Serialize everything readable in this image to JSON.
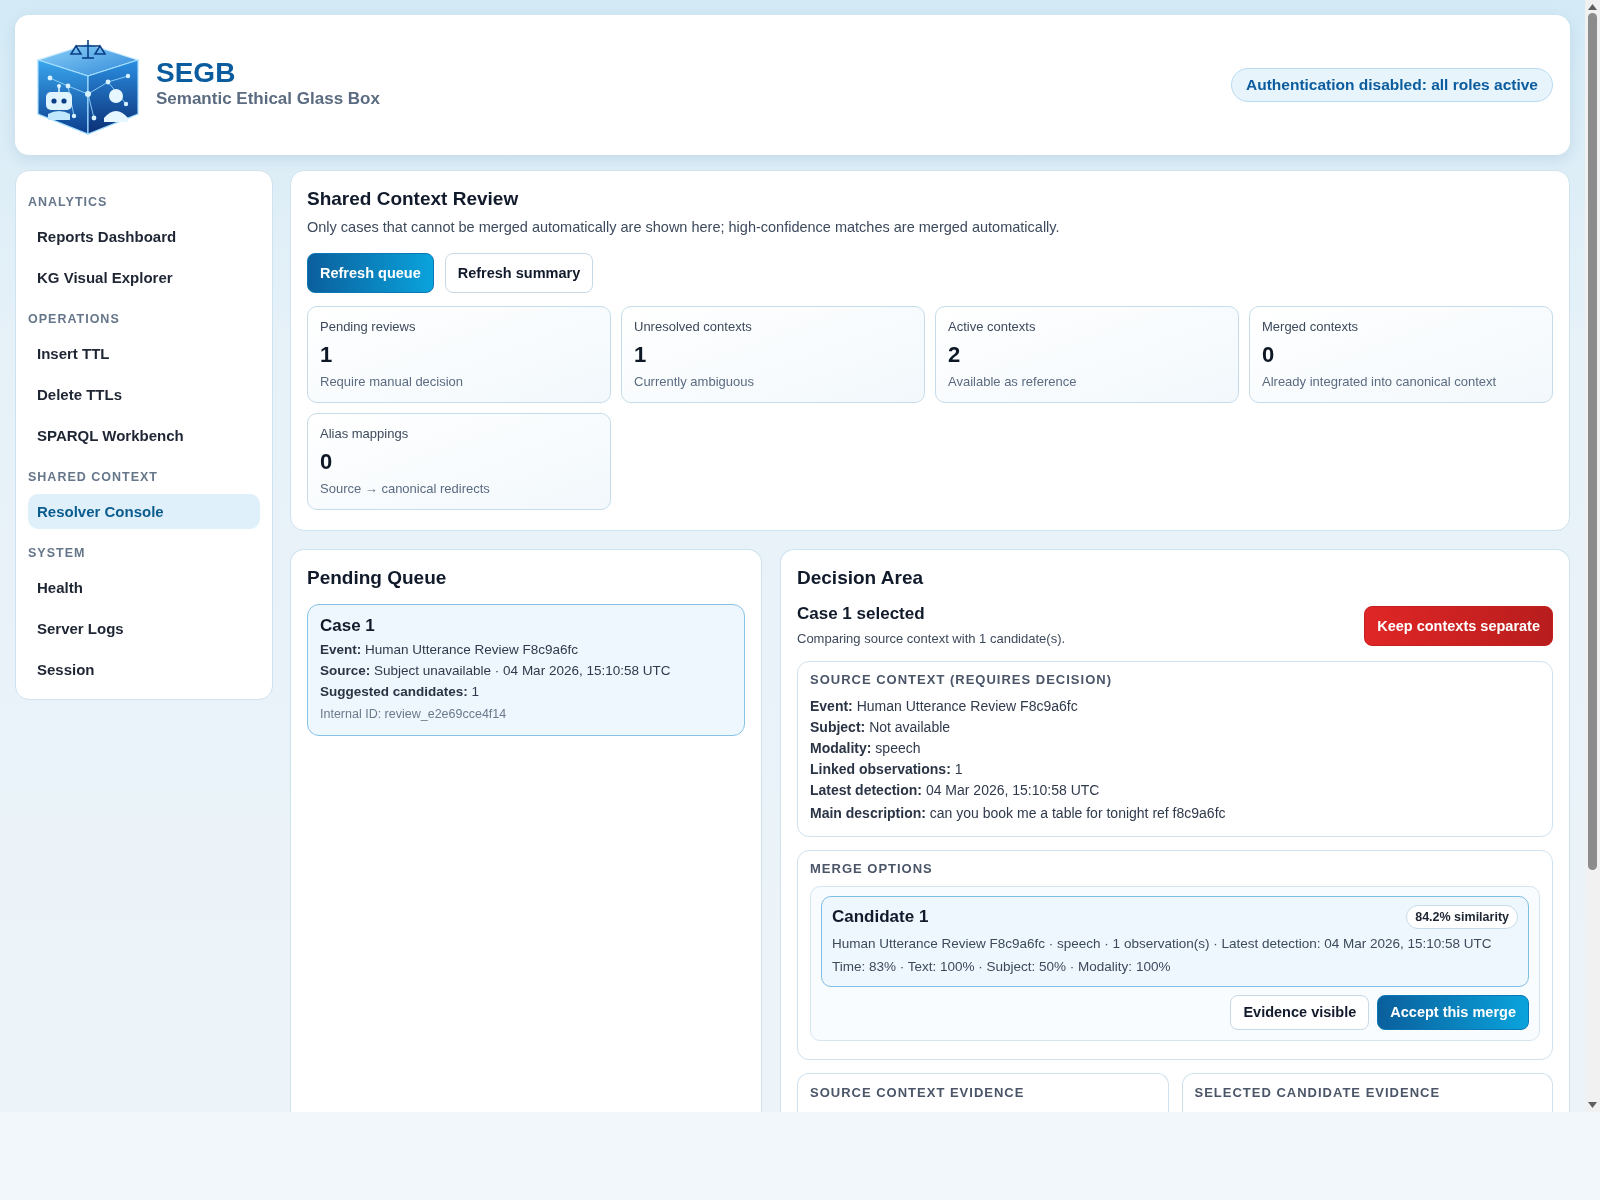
{
  "header": {
    "title": "SEGB",
    "subtitle": "Semantic Ethical Glass Box",
    "auth_badge": "Authentication disabled: all roles active"
  },
  "sidebar": {
    "sections": [
      {
        "heading": "ANALYTICS",
        "items": [
          {
            "label": "Reports Dashboard",
            "selected": false
          },
          {
            "label": "KG Visual Explorer",
            "selected": false
          }
        ]
      },
      {
        "heading": "OPERATIONS",
        "items": [
          {
            "label": "Insert TTL",
            "selected": false
          },
          {
            "label": "Delete TTLs",
            "selected": false
          },
          {
            "label": "SPARQL Workbench",
            "selected": false
          }
        ]
      },
      {
        "heading": "SHARED CONTEXT",
        "items": [
          {
            "label": "Resolver Console",
            "selected": true
          }
        ]
      },
      {
        "heading": "SYSTEM",
        "items": [
          {
            "label": "Health",
            "selected": false
          },
          {
            "label": "Server Logs",
            "selected": false
          },
          {
            "label": "Session",
            "selected": false
          }
        ]
      }
    ]
  },
  "review": {
    "title": "Shared Context Review",
    "description": "Only cases that cannot be merged automatically are shown here; high-confidence matches are merged automatically.",
    "buttons": [
      {
        "label": "Refresh queue",
        "kind": "primary"
      },
      {
        "label": "Refresh summary",
        "kind": "secondary"
      }
    ],
    "stats": [
      {
        "label": "Pending reviews",
        "value": "1",
        "note": "Require manual decision"
      },
      {
        "label": "Unresolved contexts",
        "value": "1",
        "note": "Currently ambiguous"
      },
      {
        "label": "Active contexts",
        "value": "2",
        "note": "Available as reference"
      },
      {
        "label": "Merged contexts",
        "value": "0",
        "note": "Already integrated into canonical context"
      },
      {
        "label": "Alias mappings",
        "value": "0",
        "note": "Source → canonical redirects"
      }
    ]
  },
  "pending_queue": {
    "title": "Pending Queue",
    "cases": [
      {
        "title": "Case 1",
        "selected": true,
        "fields": [
          {
            "label": "Event:",
            "value": "Human Utterance Review F8c9a6fc"
          },
          {
            "label": "Source:",
            "value": "Subject unavailable · 04 Mar 2026, 15:10:58 UTC"
          },
          {
            "label": "Suggested candidates:",
            "value": "1"
          }
        ],
        "internal_id": "Internal ID: review_e2e69cce4f14"
      }
    ]
  },
  "decision": {
    "title": "Decision Area",
    "case_title": "Case 1 selected",
    "comparison": "Comparing source context with 1 candidate(s).",
    "reject_button": {
      "label": "Keep contexts separate",
      "kind": "danger"
    },
    "source_context": {
      "heading": "SOURCE CONTEXT (REQUIRES DECISION)",
      "fields": [
        {
          "label": "Event:",
          "value": "Human Utterance Review F8c9a6fc"
        },
        {
          "label": "Subject:",
          "value": "Not available"
        },
        {
          "label": "Modality:",
          "value": "speech"
        },
        {
          "label": "Linked observations:",
          "value": "1"
        },
        {
          "label": "Latest detection:",
          "value": "04 Mar 2026, 15:10:58 UTC"
        },
        {
          "label": "Main description:",
          "value": "can you book me a table for tonight ref f8c9a6fc"
        }
      ]
    },
    "merge_options": {
      "heading": "MERGE OPTIONS",
      "candidates": [
        {
          "title": "Candidate 1",
          "similarity": "84.2% similarity",
          "selected": true,
          "summary": "Human Utterance Review F8c9a6fc · speech · 1 observation(s) · Latest detection: 04 Mar 2026, 15:10:58 UTC",
          "scores": "Time: 83% · Text: 100% · Subject: 50% · Modality: 100%",
          "actions": [
            {
              "label": "Evidence visible",
              "kind": "secondary"
            },
            {
              "label": "Accept this merge",
              "kind": "primary"
            }
          ]
        }
      ]
    },
    "evidence": [
      {
        "heading": "SOURCE CONTEXT EVIDENCE"
      },
      {
        "heading": "SELECTED CANDIDATE EVIDENCE"
      }
    ]
  }
}
